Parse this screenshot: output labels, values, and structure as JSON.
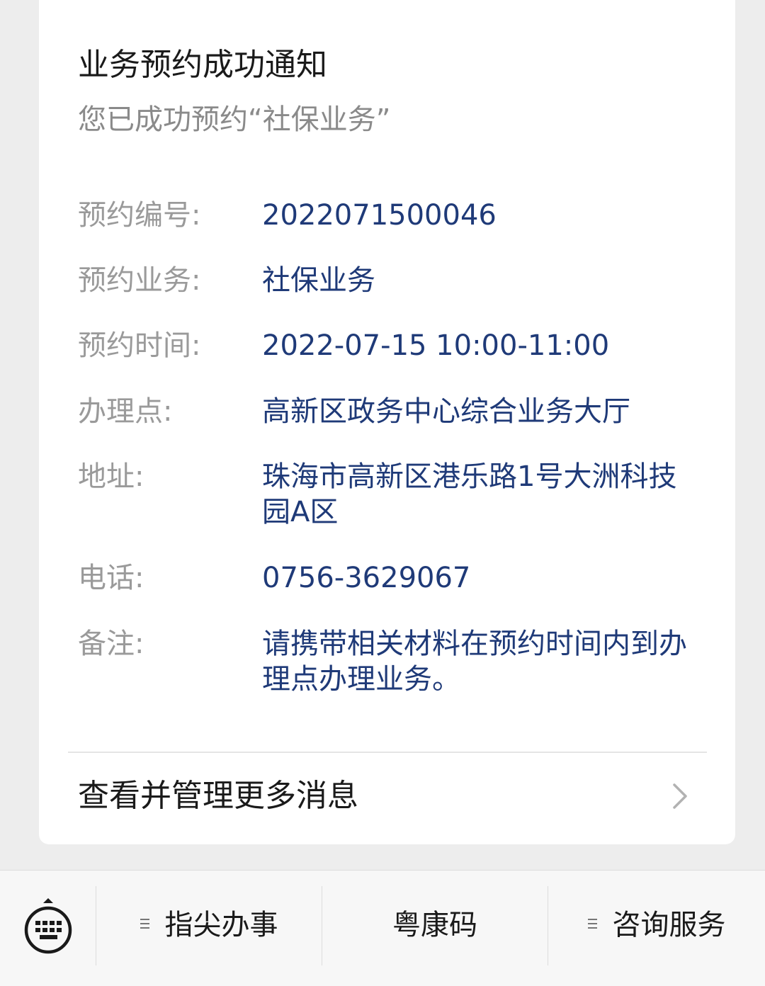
{
  "notice": {
    "title": "业务预约成功通知",
    "subtitle": "您已成功预约“社保业务”",
    "fields": [
      {
        "label": "预约编号:",
        "value": "2022071500046"
      },
      {
        "label": "预约业务:",
        "value": "社保业务"
      },
      {
        "label": "预约时间:",
        "value": "2022-07-15 10:00-11:00"
      },
      {
        "label": "办理点:",
        "value": "高新区政务中心综合业务大厅"
      },
      {
        "label": "地址:",
        "value": "珠海市高新区港乐路1号大洲科技园A区"
      },
      {
        "label": "电话:",
        "value": "0756-3629067"
      },
      {
        "label": "备注:",
        "value": "请携带相关材料在预约时间内到办理点办理业务。"
      }
    ],
    "more_link_label": "查看并管理更多消息"
  },
  "bottom_menu": {
    "items": [
      {
        "label": "指尖办事",
        "has_submenu": true
      },
      {
        "label": "粤康码",
        "has_submenu": false
      },
      {
        "label": "咨询服务",
        "has_submenu": true
      }
    ]
  },
  "colors": {
    "value_text": "#1f3a78",
    "label_text": "#9a9a9a",
    "page_background": "#ededed"
  }
}
